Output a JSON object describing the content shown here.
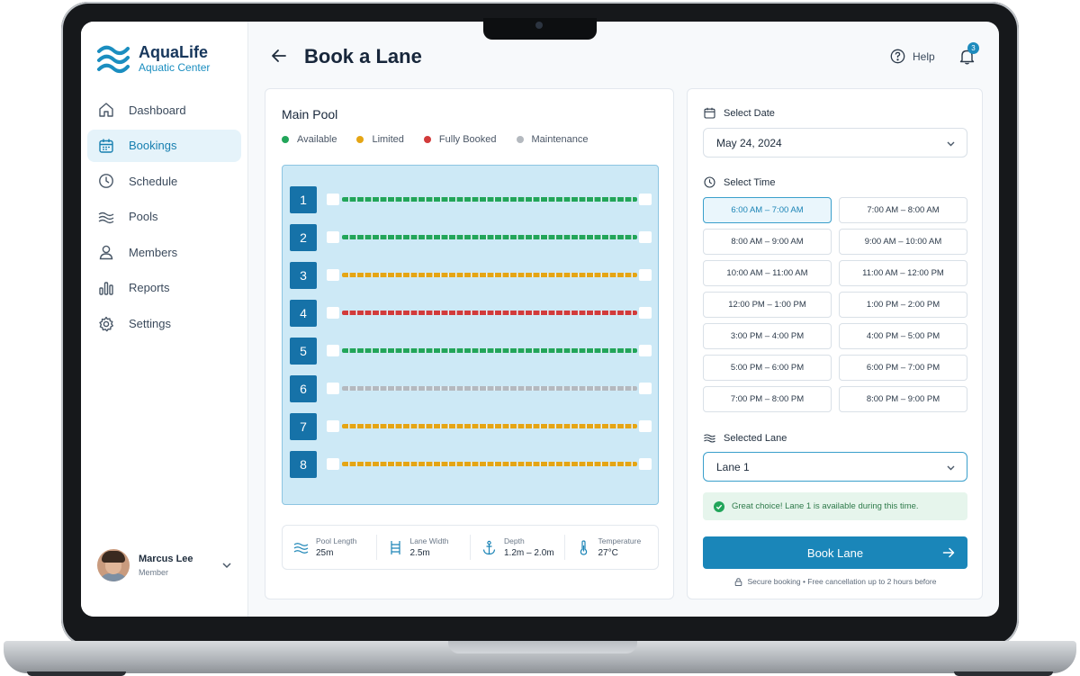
{
  "brand": {
    "name": "AquaLife",
    "subtitle": "Aquatic Center"
  },
  "sidebar": {
    "items": [
      {
        "label": "Dashboard",
        "icon": "home-icon",
        "active": false
      },
      {
        "label": "Bookings",
        "icon": "calendar-icon",
        "active": true
      },
      {
        "label": "Schedule",
        "icon": "clock-icon",
        "active": false
      },
      {
        "label": "Pools",
        "icon": "waves-icon",
        "active": false
      },
      {
        "label": "Members",
        "icon": "user-icon",
        "active": false
      },
      {
        "label": "Reports",
        "icon": "bar-chart-icon",
        "active": false
      },
      {
        "label": "Settings",
        "icon": "gear-icon",
        "active": false
      }
    ]
  },
  "user": {
    "name": "Marcus Lee",
    "role": "Member"
  },
  "header": {
    "title": "Book a Lane",
    "help_label": "Help",
    "notification_count": "3"
  },
  "pool": {
    "title": "Main Pool",
    "legend": [
      {
        "label": "Available",
        "color": "#22a55a"
      },
      {
        "label": "Limited",
        "color": "#e5a514"
      },
      {
        "label": "Fully Booked",
        "color": "#d23b3b"
      },
      {
        "label": "Maintenance",
        "color": "#b4b9bf"
      }
    ],
    "lanes": [
      {
        "number": "1",
        "status": "available"
      },
      {
        "number": "2",
        "status": "available"
      },
      {
        "number": "3",
        "status": "limited"
      },
      {
        "number": "4",
        "status": "fully-booked"
      },
      {
        "number": "5",
        "status": "available"
      },
      {
        "number": "6",
        "status": "maintenance"
      },
      {
        "number": "7",
        "status": "limited"
      },
      {
        "number": "8",
        "status": "limited"
      }
    ],
    "status_colors": {
      "available": "#22a55a",
      "limited": "#e5a514",
      "fully-booked": "#d23b3b",
      "maintenance": "#b4b9bf"
    },
    "stats": [
      {
        "label": "Pool Length",
        "value": "25m",
        "icon": "waves-icon"
      },
      {
        "label": "Lane Width",
        "value": "2.5m",
        "icon": "ladder-icon"
      },
      {
        "label": "Depth",
        "value": "1.2m – 2.0m",
        "icon": "anchor-icon"
      },
      {
        "label": "Temperature",
        "value": "27°C",
        "icon": "thermometer-icon"
      }
    ]
  },
  "booking": {
    "date_label": "Select Date",
    "date_value": "May 24, 2024",
    "time_label": "Select Time",
    "time_slots": [
      {
        "label": "6:00 AM – 7:00 AM",
        "selected": true
      },
      {
        "label": "7:00 AM – 8:00 AM",
        "selected": false
      },
      {
        "label": "8:00 AM – 9:00 AM",
        "selected": false
      },
      {
        "label": "9:00 AM – 10:00 AM",
        "selected": false
      },
      {
        "label": "10:00 AM – 11:00 AM",
        "selected": false
      },
      {
        "label": "11:00 AM – 12:00 PM",
        "selected": false
      },
      {
        "label": "12:00 PM – 1:00 PM",
        "selected": false
      },
      {
        "label": "1:00 PM – 2:00 PM",
        "selected": false
      },
      {
        "label": "3:00 PM – 4:00 PM",
        "selected": false
      },
      {
        "label": "4:00 PM – 5:00 PM",
        "selected": false
      },
      {
        "label": "5:00 PM – 6:00 PM",
        "selected": false
      },
      {
        "label": "6:00 PM – 7:00 PM",
        "selected": false
      },
      {
        "label": "7:00 PM – 8:00 PM",
        "selected": false
      },
      {
        "label": "8:00 PM – 9:00 PM",
        "selected": false
      }
    ],
    "lane_label": "Selected Lane",
    "lane_value": "Lane 1",
    "success_message": "Great choice! Lane 1 is available during this time.",
    "book_button": "Book Lane",
    "secure_note": "Secure booking • Free cancellation up to 2 hours before"
  }
}
